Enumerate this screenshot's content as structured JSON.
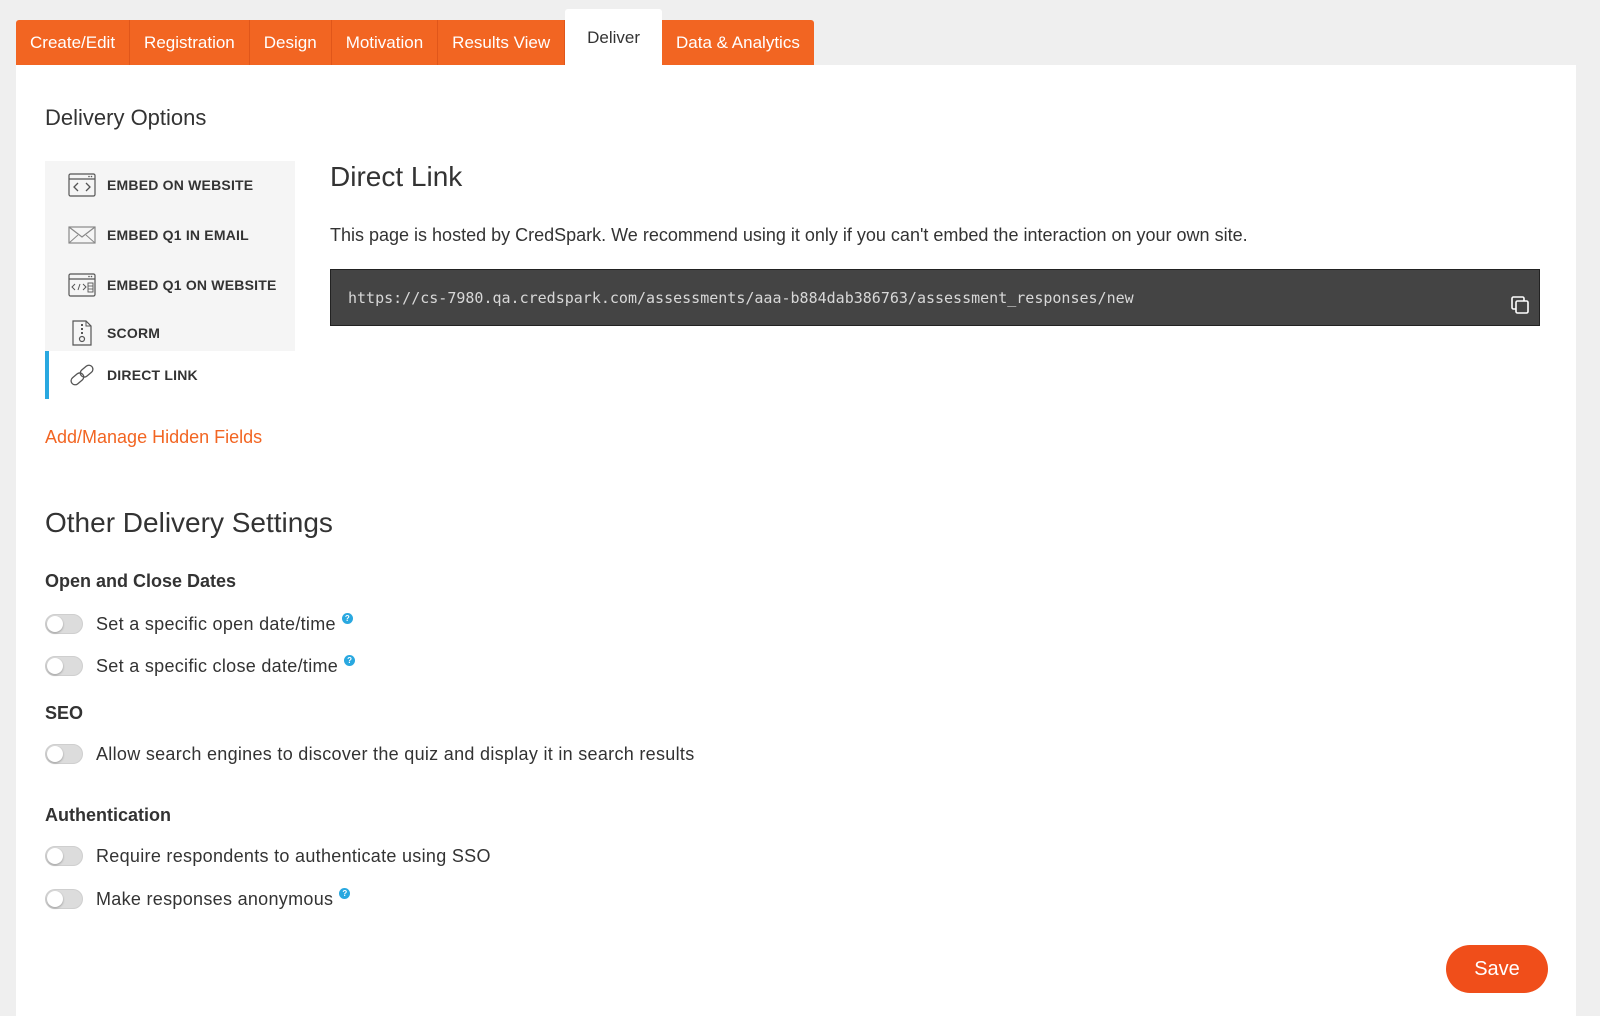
{
  "tabs": [
    {
      "label": "Create/Edit"
    },
    {
      "label": "Registration"
    },
    {
      "label": "Design"
    },
    {
      "label": "Motivation"
    },
    {
      "label": "Results View"
    },
    {
      "label": "Deliver",
      "active": true
    },
    {
      "label": "Data & Analytics"
    }
  ],
  "delivery_options": {
    "heading": "Delivery Options",
    "items": [
      {
        "label": "EMBED ON WEBSITE",
        "icon": "embed-code-icon"
      },
      {
        "label": "EMBED Q1 IN EMAIL",
        "icon": "envelope-icon"
      },
      {
        "label": "EMBED Q1 ON WEBSITE",
        "icon": "embed-window-icon"
      },
      {
        "label": "SCORM",
        "icon": "scorm-file-icon"
      },
      {
        "label": "DIRECT LINK",
        "icon": "link-icon",
        "active": true
      }
    ],
    "hidden_fields_link": "Add/Manage Hidden Fields"
  },
  "direct_link": {
    "title": "Direct Link",
    "description": "This page is hosted by CredSpark. We recommend using it only if you can't embed the interaction on your own site.",
    "url": "https://cs-7980.qa.credspark.com/assessments/aaa-b884dab386763/assessment_responses/new"
  },
  "other_settings": {
    "heading": "Other Delivery Settings",
    "open_close": {
      "heading": "Open and Close Dates",
      "open_label": "Set a specific open date/time",
      "close_label": "Set a specific close date/time"
    },
    "seo": {
      "heading": "SEO",
      "discover_label": "Allow search engines to discover the quiz and display it in search results"
    },
    "auth": {
      "heading": "Authentication",
      "sso_label": "Require respondents to authenticate using SSO",
      "anon_label": "Make responses anonymous"
    }
  },
  "save_label": "Save",
  "help_glyph": "?",
  "colors": {
    "accent": "#f26522",
    "save": "#f04e1a",
    "active_indicator": "#29a8e0",
    "url_box": "#444444"
  }
}
